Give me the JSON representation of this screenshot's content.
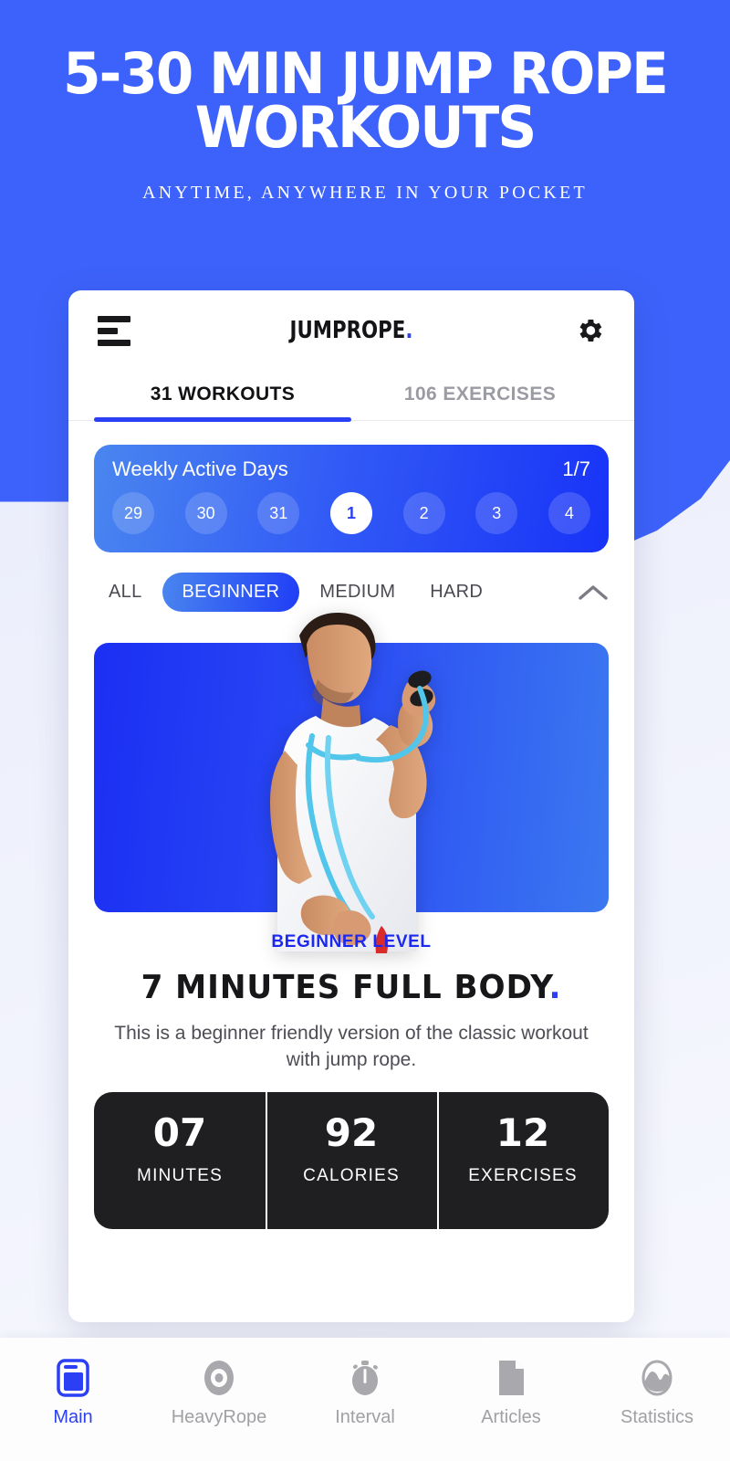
{
  "promo": {
    "title_line1": "5-30 MIN JUMP ROPE",
    "title_line2": "WORKOUTS",
    "subtitle": "ANYTIME, ANYWHERE IN YOUR POCKET"
  },
  "appbar": {
    "menu_icon": "hamburger-icon",
    "logo": "JUMPROPE",
    "logo_dot": ".",
    "settings_icon": "gear-icon"
  },
  "tabs": [
    {
      "label": "31 WORKOUTS",
      "active": true
    },
    {
      "label": "106 EXERCISES",
      "active": false
    }
  ],
  "weekly": {
    "title": "Weekly Active Days",
    "count": "1/7",
    "days": [
      {
        "label": "29",
        "selected": false
      },
      {
        "label": "30",
        "selected": false
      },
      {
        "label": "31",
        "selected": false
      },
      {
        "label": "1",
        "selected": true
      },
      {
        "label": "2",
        "selected": false
      },
      {
        "label": "3",
        "selected": false
      },
      {
        "label": "4",
        "selected": false
      }
    ]
  },
  "filters": {
    "items": [
      {
        "label": "ALL",
        "selected": false
      },
      {
        "label": "BEGINNER",
        "selected": true
      },
      {
        "label": "MEDIUM",
        "selected": false
      },
      {
        "label": "HARD",
        "selected": false
      }
    ],
    "collapse_icon": "chevron-up-icon"
  },
  "workout": {
    "level": "BEGINNER LEVEL",
    "title": "7 MINUTES FULL BODY",
    "title_dot": ".",
    "description": "This is a beginner friendly version of the classic workout with jump rope.",
    "stats": [
      {
        "value": "07",
        "label": "MINUTES"
      },
      {
        "value": "92",
        "label": "CALORIES"
      },
      {
        "value": "12",
        "label": "EXERCISES"
      }
    ]
  },
  "nav": [
    {
      "label": "Main",
      "icon": "phone-icon",
      "active": true
    },
    {
      "label": "HeavyRope",
      "icon": "target-icon",
      "active": false
    },
    {
      "label": "Interval",
      "icon": "stopwatch-icon",
      "active": false
    },
    {
      "label": "Articles",
      "icon": "document-icon",
      "active": false
    },
    {
      "label": "Statistics",
      "icon": "chart-icon",
      "active": false
    }
  ],
  "colors": {
    "brand_blue": "#3d62fb",
    "accent_blue": "#2b3ff5",
    "dark": "#1f1f22",
    "muted": "#a0a0a5"
  }
}
